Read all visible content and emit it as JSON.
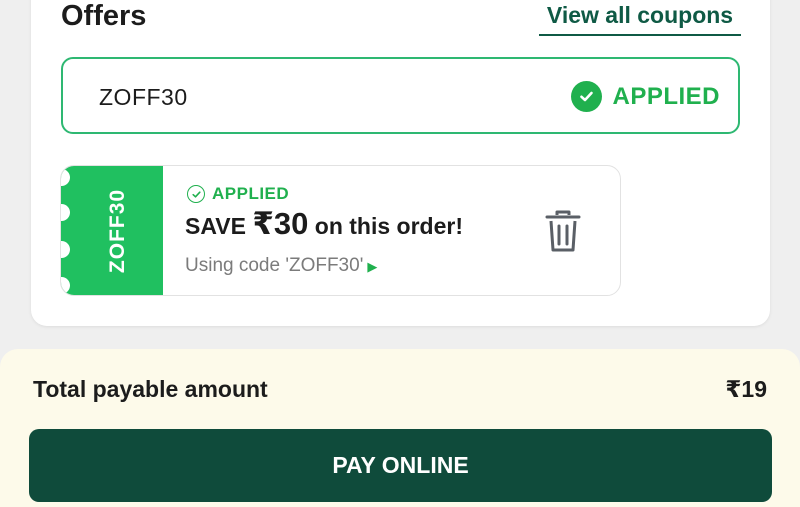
{
  "offers": {
    "title": "Offers",
    "view_all_label": "View all coupons",
    "coupon_input": {
      "value": "ZOFF30",
      "status_label": "APPLIED",
      "status_icon": "check-circle-icon"
    },
    "applied_coupon": {
      "stub_label": "ZOFF30",
      "status_label": "APPLIED",
      "save_prefix": "SAVE",
      "save_amount": "₹30",
      "save_suffix": "on this order!",
      "code_text": "Using code 'ZOFF30'",
      "remove_icon": "trash-icon"
    }
  },
  "footer": {
    "total_label": "Total payable amount",
    "total_amount": "₹19",
    "pay_button_label": "PAY ONLINE"
  },
  "colors": {
    "brand_dark_green": "#0f4b3b",
    "link_green": "#0f5a45",
    "success_green": "#20b04e",
    "stub_green": "#20c060",
    "footer_bg": "#fdfaea"
  }
}
